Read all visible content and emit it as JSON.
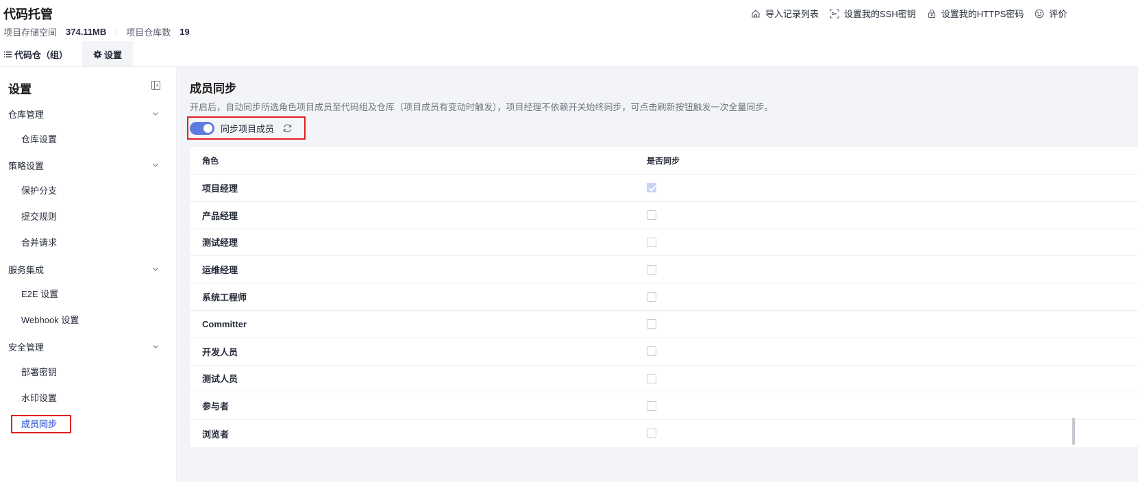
{
  "header": {
    "title": "代码托管",
    "storage_label": "项目存储空间",
    "storage_value": "374.11MB",
    "repo_count_label": "项目仓库数",
    "repo_count_value": "19",
    "actions": [
      {
        "label": "导入记录列表",
        "icon": "home-icon"
      },
      {
        "label": "设置我的SSH密钥",
        "icon": "key-icon"
      },
      {
        "label": "设置我的HTTPS密码",
        "icon": "lock-icon"
      },
      {
        "label": "评价",
        "icon": "smile-icon"
      }
    ]
  },
  "tabs": [
    {
      "label": "代码仓（组）",
      "icon": "list-icon",
      "active": false
    },
    {
      "label": "设置",
      "icon": "gear-icon",
      "active": true
    }
  ],
  "sidebar": {
    "title": "设置",
    "groups": [
      {
        "label": "仓库管理",
        "items": [
          "仓库设置"
        ]
      },
      {
        "label": "策略设置",
        "items": [
          "保护分支",
          "提交规则",
          "合并请求"
        ]
      },
      {
        "label": "服务集成",
        "items": [
          "E2E 设置",
          "Webhook 设置"
        ]
      },
      {
        "label": "安全管理",
        "items": [
          "部署密钥",
          "水印设置",
          "成员同步"
        ]
      }
    ],
    "active_item": "成员同步"
  },
  "main": {
    "title": "成员同步",
    "description": "开启后，自动同步所选角色项目成员至代码组及仓库（项目成员有变动时触发），项目经理不依赖开关始终同步，可点击刷新按钮触发一次全量同步。",
    "toggle_label": "同步项目成员",
    "toggle_on": true,
    "table": {
      "headers": [
        "角色",
        "是否同步"
      ],
      "rows": [
        {
          "role": "项目经理",
          "synced": true,
          "disabled": true
        },
        {
          "role": "产品经理",
          "synced": false
        },
        {
          "role": "测试经理",
          "synced": false
        },
        {
          "role": "运维经理",
          "synced": false
        },
        {
          "role": "系统工程师",
          "synced": false
        },
        {
          "role": "Committer",
          "synced": false
        },
        {
          "role": "开发人员",
          "synced": false
        },
        {
          "role": "测试人员",
          "synced": false
        },
        {
          "role": "参与者",
          "synced": false
        },
        {
          "role": "浏览者",
          "synced": false
        }
      ]
    }
  },
  "colors": {
    "accent": "#5e7ce0",
    "highlight_border": "#e02020",
    "main_bg": "#f3f4f7"
  }
}
